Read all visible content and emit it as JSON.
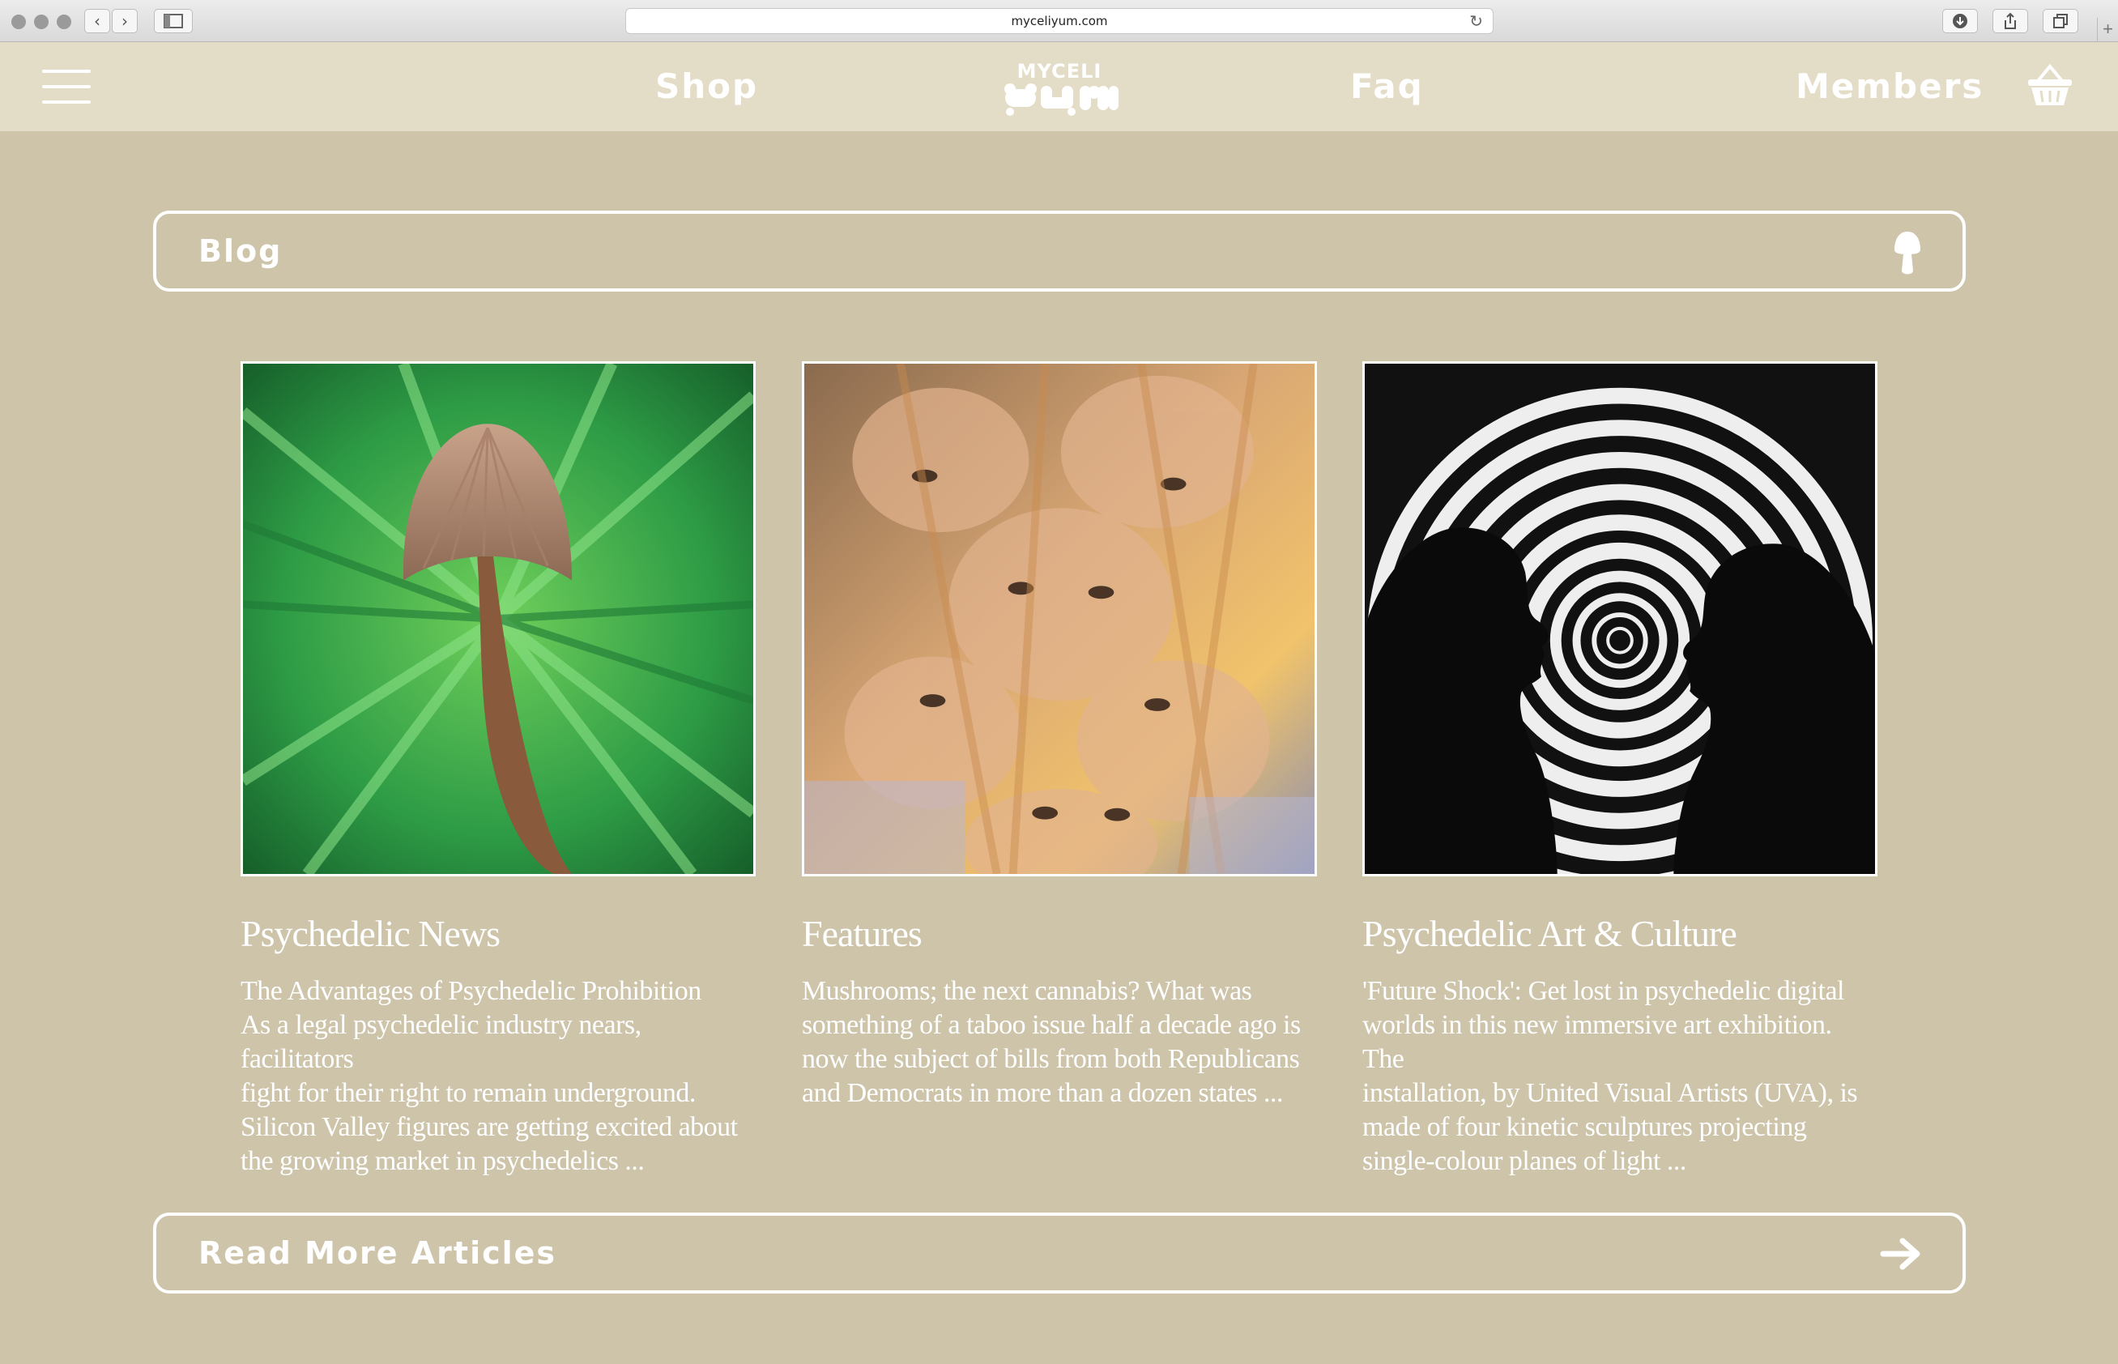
{
  "browser": {
    "url": "myceliyum.com",
    "nav_back": "‹",
    "nav_forward": "›",
    "new_tab": "+"
  },
  "header": {
    "nav": {
      "shop": "Shop",
      "faq": "Faq",
      "members": "Members"
    },
    "logo_text": "MYCELI YUM",
    "icons": [
      "menu-icon",
      "basket-icon"
    ]
  },
  "blog_bar": {
    "label": "Blog",
    "icon": "mushroom-icon"
  },
  "cards": [
    {
      "title": "Psychedelic News",
      "excerpt": "The Advantages of Psychedelic Prohibition\nAs a legal psychedelic industry nears, facilitators\nfight for their right to remain underground.\nSilicon Valley figures are getting excited about\nthe growing market in psychedelics ..."
    },
    {
      "title": "Features",
      "excerpt": "Mushrooms; the next cannabis? What was\nsomething of a taboo issue half a decade ago is\nnow the subject of bills from both Republicans\nand Democrats in more than a dozen states ..."
    },
    {
      "title": "Psychedelic Art & Culture",
      "excerpt": "'Future Shock': Get lost in psychedelic digital\nworlds in this new immersive art exhibition. The\ninstallation, by United Visual Artists (UVA), is\nmade of four kinetic sculptures projecting\nsingle-colour planes of light ..."
    }
  ],
  "read_more": {
    "label": "Read More Articles",
    "icon": "arrow-right-icon"
  },
  "colors": {
    "page_bg": "#cdc4aa",
    "header_bg": "#e3dcc6",
    "text": "#ffffff"
  }
}
